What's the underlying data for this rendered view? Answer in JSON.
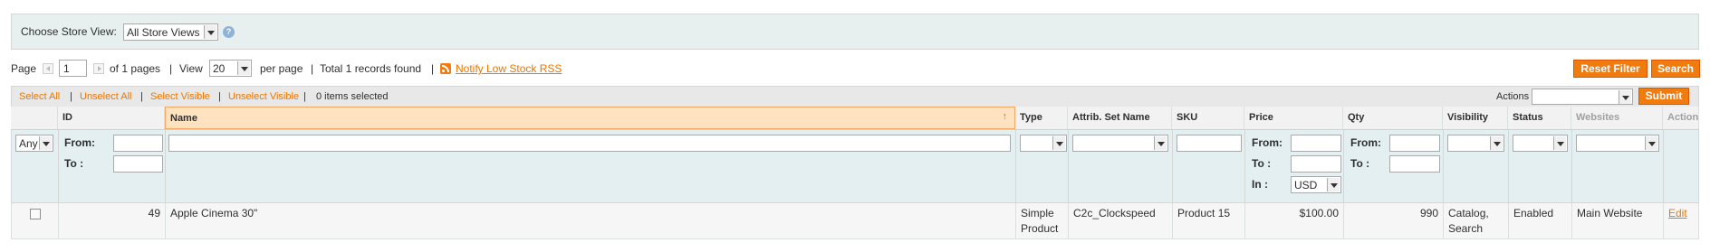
{
  "store_switcher": {
    "label": "Choose Store View:",
    "selected": "All Store Views",
    "help": "?"
  },
  "pager": {
    "page_label": "Page",
    "page_value": "1",
    "of_pages": "of 1 pages",
    "sep1": "|",
    "view_label": "View",
    "per_page_value": "20",
    "per_page_label": "per page",
    "sep2": "|",
    "total": "Total 1 records found",
    "sep3": "|",
    "rss_link": "Notify Low Stock RSS"
  },
  "buttons": {
    "reset_filter": "Reset Filter",
    "search": "Search",
    "submit": "Submit"
  },
  "massaction": {
    "select_all": "Select All",
    "unselect_all": "Unselect All",
    "select_visible": "Select Visible",
    "unselect_visible": "Unselect Visible",
    "sep": "|",
    "count": "0 items selected",
    "actions_label": "Actions",
    "actions_value": ""
  },
  "columns": {
    "id": "ID",
    "name": "Name",
    "type": "Type",
    "attrib_set": "Attrib. Set Name",
    "sku": "SKU",
    "price": "Price",
    "qty": "Qty",
    "visibility": "Visibility",
    "status": "Status",
    "websites": "Websites",
    "action": "Action"
  },
  "filters": {
    "massaction_any": "Any",
    "from": "From:",
    "to": "To :",
    "in": "In :",
    "currency": "USD"
  },
  "rows": [
    {
      "id": "49",
      "name": "Apple Cinema 30\"",
      "type_line1": "Simple",
      "type_line2": "Product",
      "attrib_set": "C2c_Clockspeed",
      "sku": "Product 15",
      "price": "$100.00",
      "qty": "990",
      "visibility_line1": "Catalog,",
      "visibility_line2": "Search",
      "status": "Enabled",
      "websites": "Main Website",
      "action": "Edit"
    }
  ],
  "colors": {
    "accent": "#ea7601",
    "button": "#f07b0e",
    "filter_bg": "#e3eff0",
    "sorted_header": "#ffe3c1"
  }
}
